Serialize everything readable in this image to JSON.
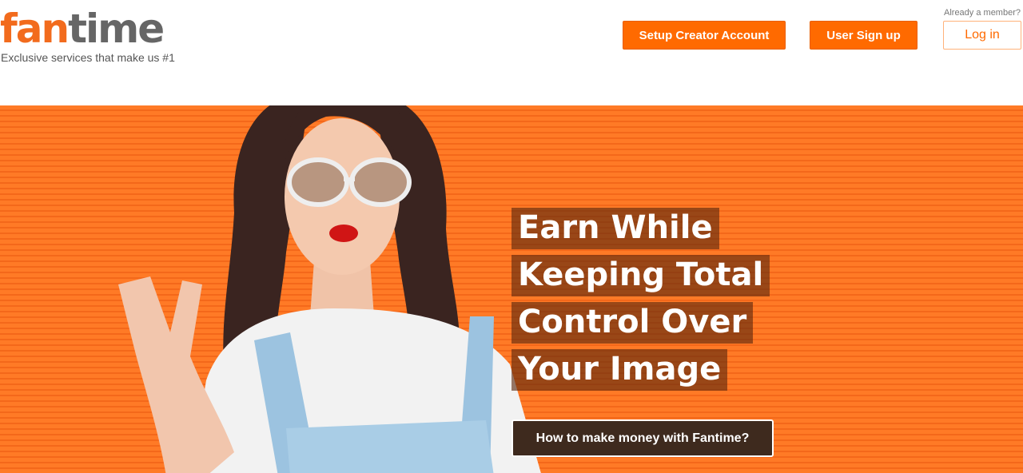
{
  "header": {
    "logo": {
      "part1": "fan",
      "part2": "time"
    },
    "tagline": "Exclusive services that make us #1",
    "already_member": "Already a member?",
    "buttons": {
      "setup_creator": "Setup Creator Account",
      "user_signup": "User Sign up",
      "login": "Log in"
    }
  },
  "hero": {
    "headline": [
      "Earn While",
      "Keeping Total",
      "Control Over",
      "Your Image"
    ],
    "cta": "How to make money with Fantime?",
    "image": "woman-with-sunglasses-peace-sign"
  },
  "colors": {
    "brand_orange": "#ff6a00",
    "logo_gray": "#666666",
    "hero_orange": "#ff7a26",
    "headline_bg": "#5a280f"
  }
}
